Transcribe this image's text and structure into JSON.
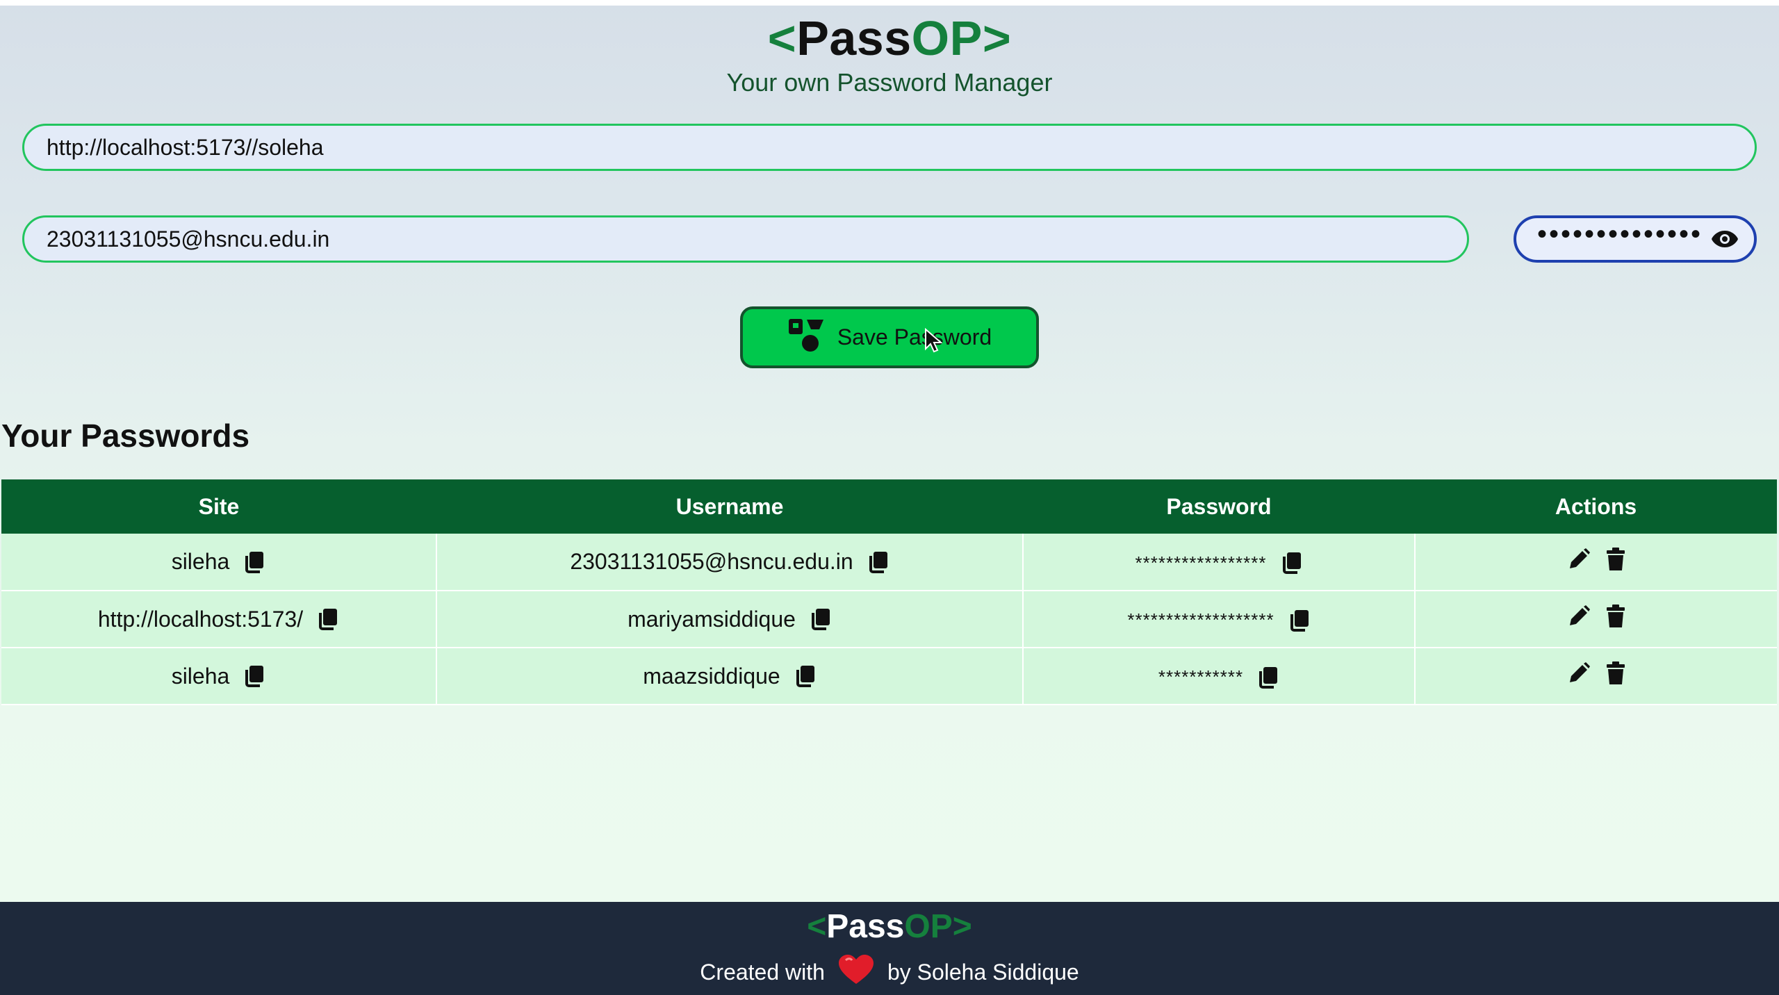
{
  "header": {
    "logo_open": "<",
    "logo_pass": "Pass",
    "logo_op": "OP",
    "logo_close": ">",
    "subtitle": "Your own Password Manager"
  },
  "form": {
    "site_value": "http://localhost:5173//soleha",
    "username_value": "23031131055@hsncu.edu.in",
    "password_masked": "••••••••••••••",
    "save_label": "Save Password"
  },
  "passwords": {
    "title": "Your Passwords",
    "columns": [
      "Site",
      "Username",
      "Password",
      "Actions"
    ],
    "rows": [
      {
        "site": "sileha",
        "username": "23031131055@hsncu.edu.in",
        "password": "*****************"
      },
      {
        "site": "http://localhost:5173/",
        "username": "mariyamsiddique",
        "password": "*******************"
      },
      {
        "site": "sileha",
        "username": "maazsiddique",
        "password": "***********"
      }
    ]
  },
  "footer": {
    "logo_open": "<",
    "logo_pass": "Pass",
    "logo_op": "OP",
    "logo_close": ">",
    "created_with": "Created with",
    "by": "by Soleha Siddique"
  },
  "colors": {
    "brand_green": "#15803d",
    "button_green": "#00c84c",
    "table_header": "#065f2e",
    "table_row": "#d3f7dc",
    "footer_bg": "#1e293b"
  },
  "icons": [
    "copy-icon",
    "edit-icon",
    "delete-icon",
    "eye-icon",
    "add-password-icon",
    "heart-icon"
  ]
}
